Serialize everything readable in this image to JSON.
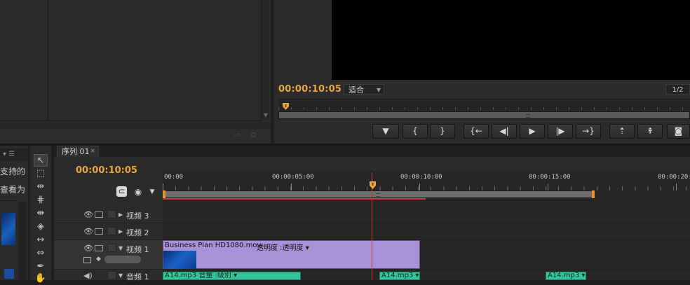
{
  "program_monitor": {
    "timecode": "00:00:10:05",
    "fit": "适合",
    "resolution": "1/2"
  },
  "transport": [
    {
      "id": "marker",
      "glyph": "▼"
    },
    {
      "id": "in",
      "glyph": "{"
    },
    {
      "id": "out",
      "glyph": "}"
    },
    {
      "id": "go-in",
      "glyph": "{←"
    },
    {
      "id": "step-back",
      "glyph": "◀|"
    },
    {
      "id": "play",
      "glyph": "▶"
    },
    {
      "id": "step-fwd",
      "glyph": "|▶"
    },
    {
      "id": "go-out",
      "glyph": "→}"
    },
    {
      "id": "lift",
      "glyph": "⇡"
    },
    {
      "id": "extract",
      "glyph": "⇞"
    },
    {
      "id": "export-frame",
      "glyph": "◙"
    }
  ],
  "media_browser": {
    "text1": "支持的",
    "text2": "查看为"
  },
  "timeline": {
    "tab_label": "序列 01",
    "close": "×",
    "timecode": "00:00:10:05",
    "ruler_labels": [
      "00:00",
      "00:00:05:00",
      "00:00:10:00",
      "00:00:15:00",
      "00:00:20:"
    ],
    "tracks": {
      "v3": "视频 3",
      "v2": "视频 2",
      "v1": "视频 1",
      "a1": "音频 1"
    },
    "video_clip": {
      "name": "Business Plan HD1080.mov",
      "fx": "透明度 :透明度 ▾"
    },
    "audio_clips": [
      {
        "label": "A14.mp3  音量 :级别 ▾"
      },
      {
        "label": "A14.mp3 ▾"
      },
      {
        "label": "A14.mp3 ▾"
      }
    ]
  },
  "colors": {
    "timecode": "#e8a640",
    "video_clip": "#a792d8",
    "audio_clip": "#35c59a",
    "playhead": "#d33333"
  }
}
